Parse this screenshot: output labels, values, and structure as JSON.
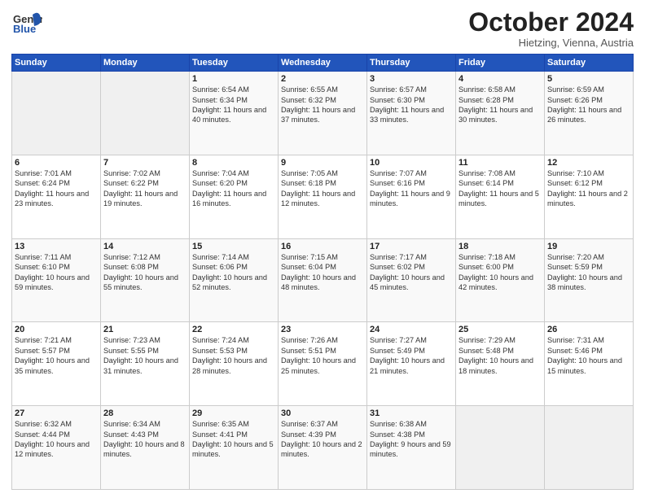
{
  "header": {
    "logo_general": "General",
    "logo_blue": "Blue",
    "month_title": "October 2024",
    "subtitle": "Hietzing, Vienna, Austria"
  },
  "weekdays": [
    "Sunday",
    "Monday",
    "Tuesday",
    "Wednesday",
    "Thursday",
    "Friday",
    "Saturday"
  ],
  "weeks": [
    [
      {
        "day": "",
        "detail": ""
      },
      {
        "day": "",
        "detail": ""
      },
      {
        "day": "1",
        "detail": "Sunrise: 6:54 AM\nSunset: 6:34 PM\nDaylight: 11 hours and 40 minutes."
      },
      {
        "day": "2",
        "detail": "Sunrise: 6:55 AM\nSunset: 6:32 PM\nDaylight: 11 hours and 37 minutes."
      },
      {
        "day": "3",
        "detail": "Sunrise: 6:57 AM\nSunset: 6:30 PM\nDaylight: 11 hours and 33 minutes."
      },
      {
        "day": "4",
        "detail": "Sunrise: 6:58 AM\nSunset: 6:28 PM\nDaylight: 11 hours and 30 minutes."
      },
      {
        "day": "5",
        "detail": "Sunrise: 6:59 AM\nSunset: 6:26 PM\nDaylight: 11 hours and 26 minutes."
      }
    ],
    [
      {
        "day": "6",
        "detail": "Sunrise: 7:01 AM\nSunset: 6:24 PM\nDaylight: 11 hours and 23 minutes."
      },
      {
        "day": "7",
        "detail": "Sunrise: 7:02 AM\nSunset: 6:22 PM\nDaylight: 11 hours and 19 minutes."
      },
      {
        "day": "8",
        "detail": "Sunrise: 7:04 AM\nSunset: 6:20 PM\nDaylight: 11 hours and 16 minutes."
      },
      {
        "day": "9",
        "detail": "Sunrise: 7:05 AM\nSunset: 6:18 PM\nDaylight: 11 hours and 12 minutes."
      },
      {
        "day": "10",
        "detail": "Sunrise: 7:07 AM\nSunset: 6:16 PM\nDaylight: 11 hours and 9 minutes."
      },
      {
        "day": "11",
        "detail": "Sunrise: 7:08 AM\nSunset: 6:14 PM\nDaylight: 11 hours and 5 minutes."
      },
      {
        "day": "12",
        "detail": "Sunrise: 7:10 AM\nSunset: 6:12 PM\nDaylight: 11 hours and 2 minutes."
      }
    ],
    [
      {
        "day": "13",
        "detail": "Sunrise: 7:11 AM\nSunset: 6:10 PM\nDaylight: 10 hours and 59 minutes."
      },
      {
        "day": "14",
        "detail": "Sunrise: 7:12 AM\nSunset: 6:08 PM\nDaylight: 10 hours and 55 minutes."
      },
      {
        "day": "15",
        "detail": "Sunrise: 7:14 AM\nSunset: 6:06 PM\nDaylight: 10 hours and 52 minutes."
      },
      {
        "day": "16",
        "detail": "Sunrise: 7:15 AM\nSunset: 6:04 PM\nDaylight: 10 hours and 48 minutes."
      },
      {
        "day": "17",
        "detail": "Sunrise: 7:17 AM\nSunset: 6:02 PM\nDaylight: 10 hours and 45 minutes."
      },
      {
        "day": "18",
        "detail": "Sunrise: 7:18 AM\nSunset: 6:00 PM\nDaylight: 10 hours and 42 minutes."
      },
      {
        "day": "19",
        "detail": "Sunrise: 7:20 AM\nSunset: 5:59 PM\nDaylight: 10 hours and 38 minutes."
      }
    ],
    [
      {
        "day": "20",
        "detail": "Sunrise: 7:21 AM\nSunset: 5:57 PM\nDaylight: 10 hours and 35 minutes."
      },
      {
        "day": "21",
        "detail": "Sunrise: 7:23 AM\nSunset: 5:55 PM\nDaylight: 10 hours and 31 minutes."
      },
      {
        "day": "22",
        "detail": "Sunrise: 7:24 AM\nSunset: 5:53 PM\nDaylight: 10 hours and 28 minutes."
      },
      {
        "day": "23",
        "detail": "Sunrise: 7:26 AM\nSunset: 5:51 PM\nDaylight: 10 hours and 25 minutes."
      },
      {
        "day": "24",
        "detail": "Sunrise: 7:27 AM\nSunset: 5:49 PM\nDaylight: 10 hours and 21 minutes."
      },
      {
        "day": "25",
        "detail": "Sunrise: 7:29 AM\nSunset: 5:48 PM\nDaylight: 10 hours and 18 minutes."
      },
      {
        "day": "26",
        "detail": "Sunrise: 7:31 AM\nSunset: 5:46 PM\nDaylight: 10 hours and 15 minutes."
      }
    ],
    [
      {
        "day": "27",
        "detail": "Sunrise: 6:32 AM\nSunset: 4:44 PM\nDaylight: 10 hours and 12 minutes."
      },
      {
        "day": "28",
        "detail": "Sunrise: 6:34 AM\nSunset: 4:43 PM\nDaylight: 10 hours and 8 minutes."
      },
      {
        "day": "29",
        "detail": "Sunrise: 6:35 AM\nSunset: 4:41 PM\nDaylight: 10 hours and 5 minutes."
      },
      {
        "day": "30",
        "detail": "Sunrise: 6:37 AM\nSunset: 4:39 PM\nDaylight: 10 hours and 2 minutes."
      },
      {
        "day": "31",
        "detail": "Sunrise: 6:38 AM\nSunset: 4:38 PM\nDaylight: 9 hours and 59 minutes."
      },
      {
        "day": "",
        "detail": ""
      },
      {
        "day": "",
        "detail": ""
      }
    ]
  ]
}
